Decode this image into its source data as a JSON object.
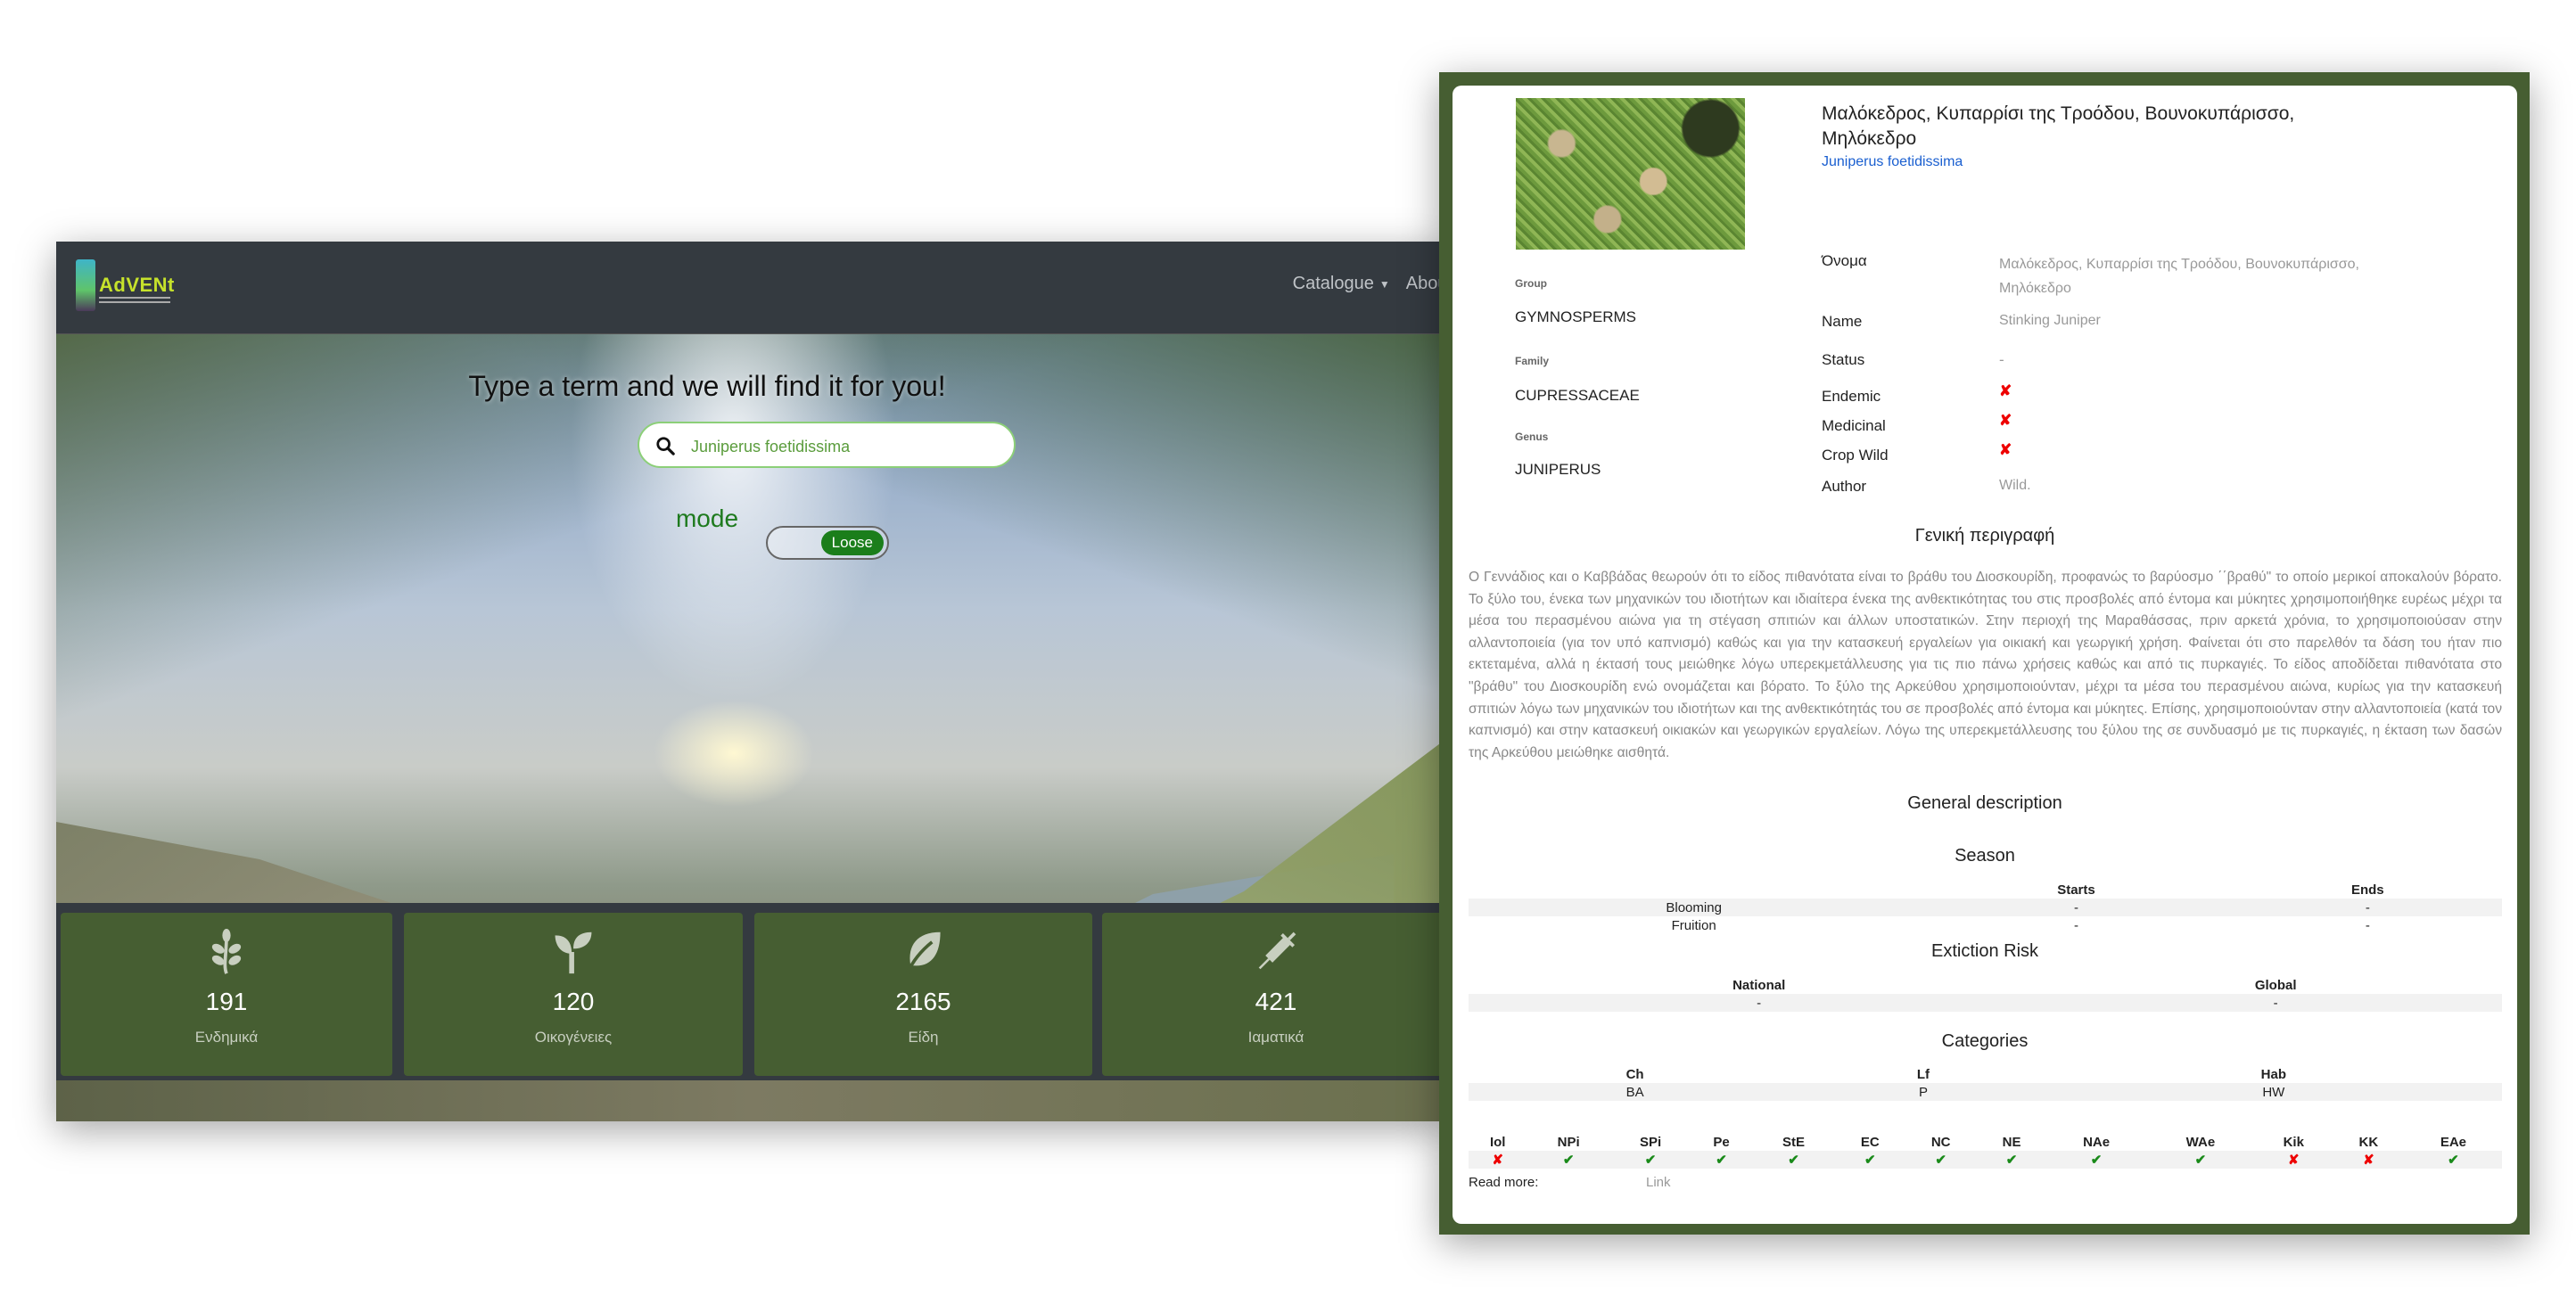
{
  "home": {
    "logo_text": "AdVENt",
    "nav": {
      "catalogue": "Catalogue",
      "about": "About"
    },
    "hero_title": "Type a term and we will find it for you!",
    "search": {
      "value": "Juniperus foetidissima",
      "icon": "search-icon"
    },
    "mode_label": "mode",
    "mode_toggle": "Loose",
    "stats": [
      {
        "icon": "herb-icon",
        "value": "191",
        "label": "Ενδημικά"
      },
      {
        "icon": "seedling-icon",
        "value": "120",
        "label": "Οικογένειες"
      },
      {
        "icon": "leaf-icon",
        "value": "2165",
        "label": "Είδη"
      },
      {
        "icon": "syringe-icon",
        "value": "421",
        "label": "Ιαματικά"
      }
    ]
  },
  "detail": {
    "title": "Μαλόκεδρος, Κυπαρρίσι της Τροόδου, Βουνοκυπάρισσο, Μηλόκεδρο",
    "latin_name": "Juniperus foetidissima",
    "taxonomy": {
      "group_label": "Group",
      "group": "GYMNOSPERMS",
      "family_label": "Family",
      "family": "CUPRESSACEAE",
      "genus_label": "Genus",
      "genus": "JUNIPERUS"
    },
    "fields": {
      "onoma_label": "Όνομα",
      "onoma": "Μαλόκεδρος, Κυπαρρίσι της Τροόδου, Βουνοκυπάρισσο, Μηλόκεδρο",
      "name_label": "Name",
      "name": "Stinking Juniper",
      "status_label": "Status",
      "status": "-",
      "endemic_label": "Endemic",
      "endemic": "✘",
      "medicinal_label": "Medicinal",
      "medicinal": "✘",
      "cropwild_label": "Crop Wild",
      "cropwild": "✘",
      "author_label": "Author",
      "author": "Wild."
    },
    "greek_desc_title": "Γενική περιγραφή",
    "greek_desc": "Ο Γεννάδιος και ο Καββάδας θεωρούν ότι το είδος πιθανότατα είναι το βράθυ του Διοσκουρίδη, προφανώς το βαρύοσμο ΄΄βραθύ\" το οποίο μερικοί αποκαλούν βόρατο. Το ξύλο του, ένεκα των μηχανικών του ιδιοτήτων και ιδιαίτερα ένεκα της ανθεκτικότητας του στις προσβολές από έντομα και μύκητες χρησιμοποιήθηκε ευρέως μέχρι τα μέσα του περασμένου αιώνα για τη στέγαση σπιτιών και άλλων υποστατικών. Στην περιοχή της Μαραθάσσας, πριν αρκετά χρόνια, το χρησιμοποιούσαν στην αλλαντοποιεία (για τον υπό καπνισμό) καθώς και για την κατασκευή εργαλείων για οικιακή και γεωργική χρήση. Φαίνεται ότι στο παρελθόν τα δάση του ήταν πιο εκτεταμένα, αλλά η έκτασή τους μειώθηκε λόγω υπερεκμετάλλευσης για τις πιο πάνω χρήσεις καθώς και από τις πυρκαγιές. Το είδος αποδίδεται πιθανότατα στο \"βράθυ\" του Διοσκουρίδη ενώ ονομάζεται και βόρατο. Το ξύλο της Αρκεύθου χρησιμοποιούνταν, μέχρι τα μέσα του περασμένου αιώνα, κυρίως για την κατασκευή σπιτιών λόγω των μηχανικών του ιδιοτήτων και της ανθεκτικότητάς του σε προσβολές από έντομα και μύκητες. Επίσης, χρησιμοποιούνταν στην αλλαντοποιεία (κατά τον καπνισμό) και στην κατασκευή οικιακών και γεωργικών εργαλείων. Λόγω της υπερεκμετάλλευσης του ξύλου της σε συνδυασμό με τις πυρκαγιές, η έκταση των δασών της Αρκεύθου μειώθηκε αισθητά.",
    "general_desc_title": "General description",
    "season": {
      "title": "Season",
      "headers": [
        "",
        "Starts",
        "Ends"
      ],
      "rows": [
        [
          "Blooming",
          "-",
          "-"
        ],
        [
          "Fruition",
          "-",
          "-"
        ]
      ]
    },
    "extinction": {
      "title": "Extiction Risk",
      "headers": [
        "National",
        "Global"
      ],
      "row": [
        "-",
        "-"
      ]
    },
    "categories": {
      "title": "Categories",
      "headers": [
        "Ch",
        "Lf",
        "Hab"
      ],
      "row": [
        "BA",
        "P",
        "HW"
      ]
    },
    "regions": {
      "headers": [
        "Iol",
        "NPi",
        "SPi",
        "Pe",
        "StE",
        "EC",
        "NC",
        "NE",
        "NAe",
        "WAe",
        "Kik",
        "KK",
        "EAe"
      ],
      "values": [
        "✘",
        "✔",
        "✔",
        "✔",
        "✔",
        "✔",
        "✔",
        "✔",
        "✔",
        "✔",
        "✘",
        "✘",
        "✔"
      ]
    },
    "read_more_label": "Read more:",
    "link_label": "Link"
  },
  "colors": {
    "brand_green": "#465e32",
    "navbar": "#343a40",
    "check": "#1a8a1a",
    "cross": "#e00000",
    "latin_link": "#1a5fd0"
  }
}
